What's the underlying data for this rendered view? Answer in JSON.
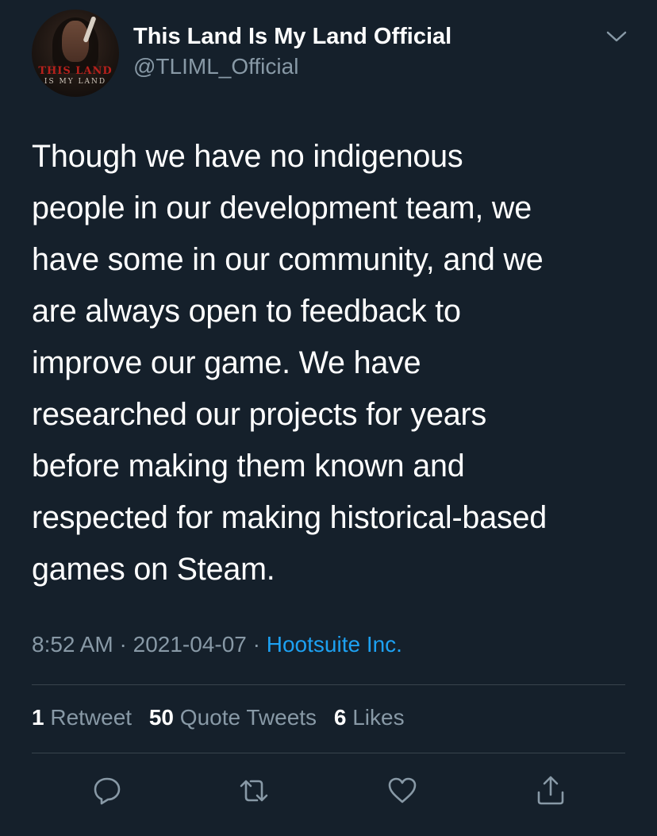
{
  "author": {
    "display_name": "This Land Is My Land Official",
    "handle": "@TLIML_Official",
    "avatar_logo_line1": "THIS LAND",
    "avatar_logo_line2": "IS MY LAND"
  },
  "tweet": {
    "text": "Though we have no indigenous\npeople in our development team, we\nhave some in our community, and we\nare always open to feedback to\nimprove our game. We have\nresearched our projects for years\nbefore making them known and\nrespected for making historical-based\ngames on Steam.",
    "time": "8:52 AM",
    "date": "2021-04-07",
    "separator": " · ",
    "source": "Hootsuite Inc."
  },
  "stats": {
    "retweets_count": "1",
    "retweets_label": "Retweet",
    "quotes_count": "50",
    "quotes_label": "Quote Tweets",
    "likes_count": "6",
    "likes_label": "Likes"
  },
  "actions": {
    "reply_icon": "reply-icon",
    "retweet_icon": "retweet-icon",
    "like_icon": "heart-icon",
    "share_icon": "share-icon"
  },
  "colors": {
    "background": "#15202b",
    "secondary_text": "#8899a6",
    "link": "#1da1f2",
    "divider": "#38444d"
  }
}
